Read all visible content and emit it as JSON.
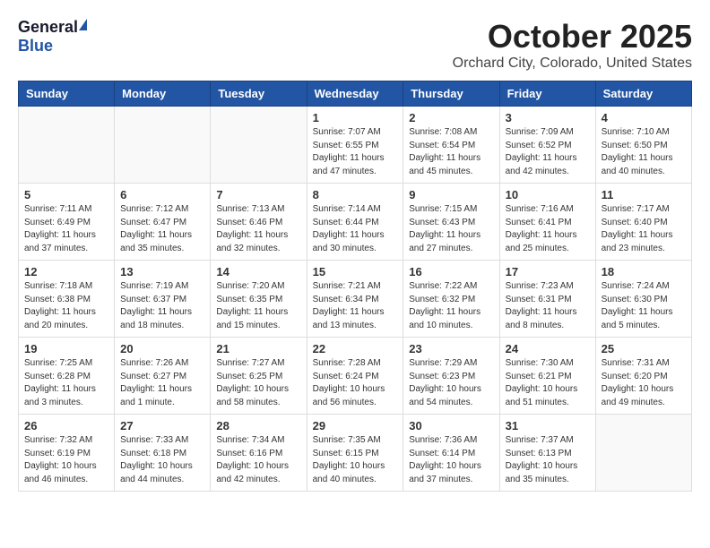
{
  "header": {
    "logo_general": "General",
    "logo_blue": "Blue",
    "month_year": "October 2025",
    "location": "Orchard City, Colorado, United States"
  },
  "calendar": {
    "weekdays": [
      "Sunday",
      "Monday",
      "Tuesday",
      "Wednesday",
      "Thursday",
      "Friday",
      "Saturday"
    ],
    "weeks": [
      [
        {
          "day": "",
          "info": ""
        },
        {
          "day": "",
          "info": ""
        },
        {
          "day": "",
          "info": ""
        },
        {
          "day": "1",
          "info": "Sunrise: 7:07 AM\nSunset: 6:55 PM\nDaylight: 11 hours\nand 47 minutes."
        },
        {
          "day": "2",
          "info": "Sunrise: 7:08 AM\nSunset: 6:54 PM\nDaylight: 11 hours\nand 45 minutes."
        },
        {
          "day": "3",
          "info": "Sunrise: 7:09 AM\nSunset: 6:52 PM\nDaylight: 11 hours\nand 42 minutes."
        },
        {
          "day": "4",
          "info": "Sunrise: 7:10 AM\nSunset: 6:50 PM\nDaylight: 11 hours\nand 40 minutes."
        }
      ],
      [
        {
          "day": "5",
          "info": "Sunrise: 7:11 AM\nSunset: 6:49 PM\nDaylight: 11 hours\nand 37 minutes."
        },
        {
          "day": "6",
          "info": "Sunrise: 7:12 AM\nSunset: 6:47 PM\nDaylight: 11 hours\nand 35 minutes."
        },
        {
          "day": "7",
          "info": "Sunrise: 7:13 AM\nSunset: 6:46 PM\nDaylight: 11 hours\nand 32 minutes."
        },
        {
          "day": "8",
          "info": "Sunrise: 7:14 AM\nSunset: 6:44 PM\nDaylight: 11 hours\nand 30 minutes."
        },
        {
          "day": "9",
          "info": "Sunrise: 7:15 AM\nSunset: 6:43 PM\nDaylight: 11 hours\nand 27 minutes."
        },
        {
          "day": "10",
          "info": "Sunrise: 7:16 AM\nSunset: 6:41 PM\nDaylight: 11 hours\nand 25 minutes."
        },
        {
          "day": "11",
          "info": "Sunrise: 7:17 AM\nSunset: 6:40 PM\nDaylight: 11 hours\nand 23 minutes."
        }
      ],
      [
        {
          "day": "12",
          "info": "Sunrise: 7:18 AM\nSunset: 6:38 PM\nDaylight: 11 hours\nand 20 minutes."
        },
        {
          "day": "13",
          "info": "Sunrise: 7:19 AM\nSunset: 6:37 PM\nDaylight: 11 hours\nand 18 minutes."
        },
        {
          "day": "14",
          "info": "Sunrise: 7:20 AM\nSunset: 6:35 PM\nDaylight: 11 hours\nand 15 minutes."
        },
        {
          "day": "15",
          "info": "Sunrise: 7:21 AM\nSunset: 6:34 PM\nDaylight: 11 hours\nand 13 minutes."
        },
        {
          "day": "16",
          "info": "Sunrise: 7:22 AM\nSunset: 6:32 PM\nDaylight: 11 hours\nand 10 minutes."
        },
        {
          "day": "17",
          "info": "Sunrise: 7:23 AM\nSunset: 6:31 PM\nDaylight: 11 hours\nand 8 minutes."
        },
        {
          "day": "18",
          "info": "Sunrise: 7:24 AM\nSunset: 6:30 PM\nDaylight: 11 hours\nand 5 minutes."
        }
      ],
      [
        {
          "day": "19",
          "info": "Sunrise: 7:25 AM\nSunset: 6:28 PM\nDaylight: 11 hours\nand 3 minutes."
        },
        {
          "day": "20",
          "info": "Sunrise: 7:26 AM\nSunset: 6:27 PM\nDaylight: 11 hours\nand 1 minute."
        },
        {
          "day": "21",
          "info": "Sunrise: 7:27 AM\nSunset: 6:25 PM\nDaylight: 10 hours\nand 58 minutes."
        },
        {
          "day": "22",
          "info": "Sunrise: 7:28 AM\nSunset: 6:24 PM\nDaylight: 10 hours\nand 56 minutes."
        },
        {
          "day": "23",
          "info": "Sunrise: 7:29 AM\nSunset: 6:23 PM\nDaylight: 10 hours\nand 54 minutes."
        },
        {
          "day": "24",
          "info": "Sunrise: 7:30 AM\nSunset: 6:21 PM\nDaylight: 10 hours\nand 51 minutes."
        },
        {
          "day": "25",
          "info": "Sunrise: 7:31 AM\nSunset: 6:20 PM\nDaylight: 10 hours\nand 49 minutes."
        }
      ],
      [
        {
          "day": "26",
          "info": "Sunrise: 7:32 AM\nSunset: 6:19 PM\nDaylight: 10 hours\nand 46 minutes."
        },
        {
          "day": "27",
          "info": "Sunrise: 7:33 AM\nSunset: 6:18 PM\nDaylight: 10 hours\nand 44 minutes."
        },
        {
          "day": "28",
          "info": "Sunrise: 7:34 AM\nSunset: 6:16 PM\nDaylight: 10 hours\nand 42 minutes."
        },
        {
          "day": "29",
          "info": "Sunrise: 7:35 AM\nSunset: 6:15 PM\nDaylight: 10 hours\nand 40 minutes."
        },
        {
          "day": "30",
          "info": "Sunrise: 7:36 AM\nSunset: 6:14 PM\nDaylight: 10 hours\nand 37 minutes."
        },
        {
          "day": "31",
          "info": "Sunrise: 7:37 AM\nSunset: 6:13 PM\nDaylight: 10 hours\nand 35 minutes."
        },
        {
          "day": "",
          "info": ""
        }
      ]
    ]
  }
}
